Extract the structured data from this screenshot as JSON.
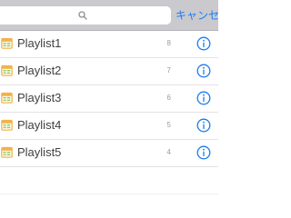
{
  "search": {
    "placeholder": "",
    "value": "",
    "cancel_label": "キャンセル"
  },
  "playlists": [
    {
      "name": "Playlist1",
      "count": "8"
    },
    {
      "name": "Playlist2",
      "count": "7"
    },
    {
      "name": "Playlist3",
      "count": "6"
    },
    {
      "name": "Playlist4",
      "count": "5"
    },
    {
      "name": "Playlist5",
      "count": "4"
    }
  ],
  "icons": {
    "search": "search-icon",
    "playlist": "playlist-icon",
    "info": "info-icon"
  },
  "colors": {
    "accent": "#1a7cf2",
    "search_bar_bg": "#c9c9ce",
    "icon_orange": "#f2b24b",
    "icon_green": "#8dcf63",
    "separator": "#e3e3e6"
  }
}
